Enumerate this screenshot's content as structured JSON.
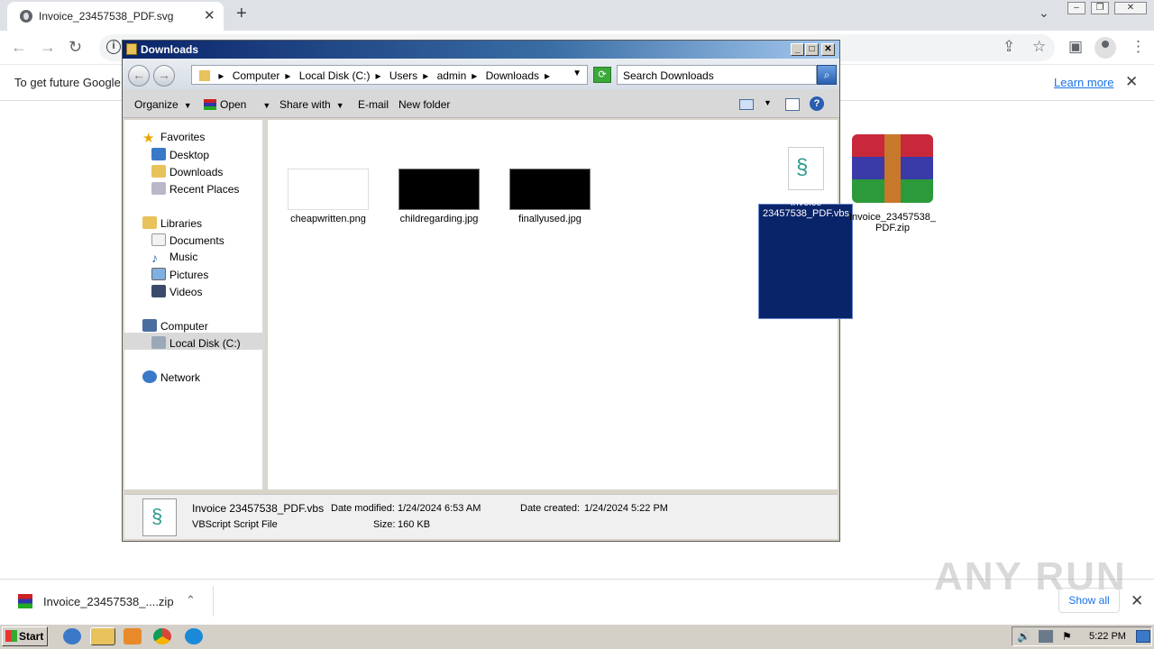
{
  "browser": {
    "tab_title": "Invoice_23457538_PDF.svg",
    "new_tab_symbol": "+",
    "infobar_text": "To get future Google",
    "learn_more": "Learn more"
  },
  "window": {
    "title": "Downloads",
    "breadcrumbs": [
      "Computer",
      "Local Disk (C:)",
      "Users",
      "admin",
      "Downloads"
    ],
    "search_placeholder": "Search Downloads"
  },
  "commands": {
    "organize": "Organize",
    "open": "Open",
    "share_with": "Share with",
    "email": "E-mail",
    "new_folder": "New folder"
  },
  "nav": {
    "favorites": "Favorites",
    "desktop": "Desktop",
    "downloads": "Downloads",
    "recent": "Recent Places",
    "libraries": "Libraries",
    "documents": "Documents",
    "music": "Music",
    "pictures": "Pictures",
    "videos": "Videos",
    "computer": "Computer",
    "local_disk": "Local Disk (C:)",
    "network": "Network"
  },
  "files": [
    {
      "name": "cheapwritten.png"
    },
    {
      "name": "childregarding.jpg"
    },
    {
      "name": "finallyused.jpg"
    },
    {
      "name_line1": "Invoice",
      "name_line2": "23457538_PDF.vbs"
    },
    {
      "name_line1": "Invoice_23457538_",
      "name_line2": "PDF.zip"
    }
  ],
  "details": {
    "name": "Invoice 23457538_PDF.vbs",
    "type": "VBScript Script File",
    "date_modified_label": "Date modified:",
    "date_modified": "1/24/2024 6:53 AM",
    "date_created_label": "Date created:",
    "date_created": "1/24/2024 5:22 PM",
    "size_label": "Size:",
    "size": "160 KB"
  },
  "downloads_bar": {
    "filename": "Invoice_23457538_....zip",
    "show_all": "Show all"
  },
  "watermark": "ANY RUN",
  "taskbar": {
    "start": "Start",
    "clock": "5:22 PM"
  }
}
